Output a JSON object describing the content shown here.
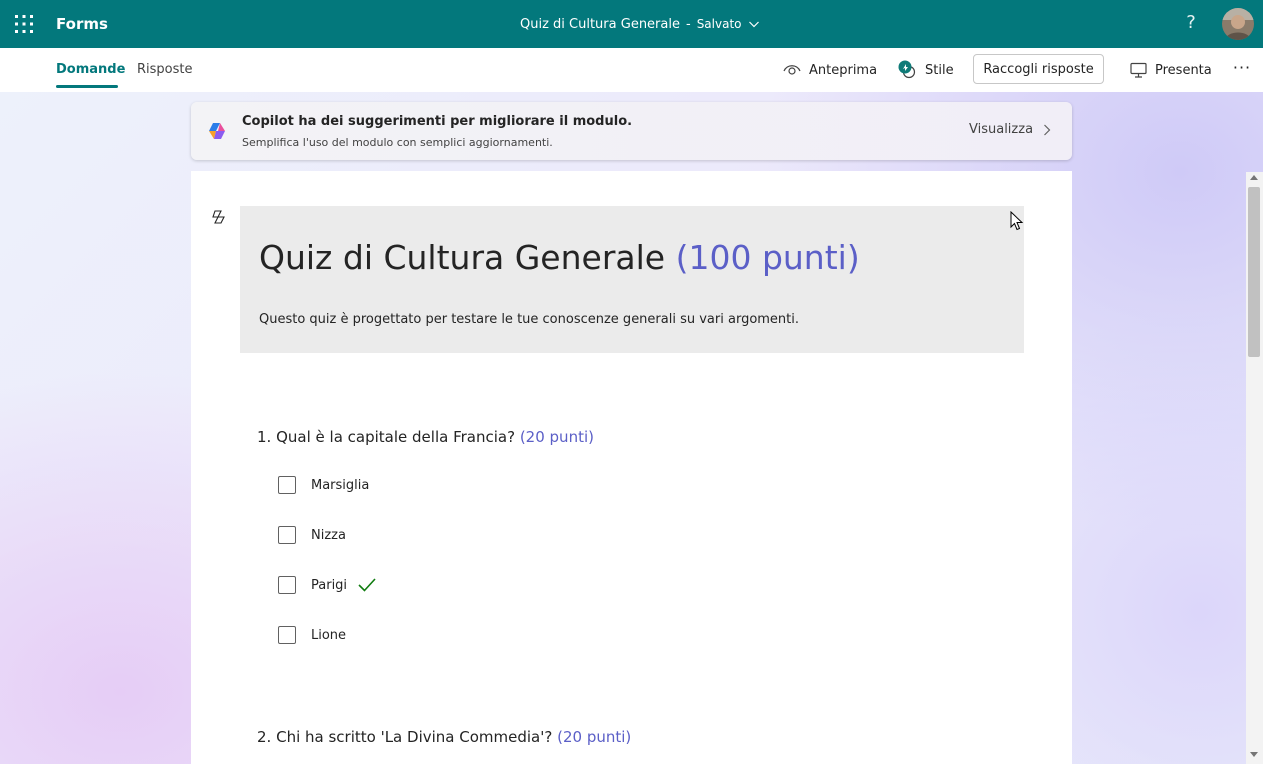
{
  "app": {
    "name": "Forms",
    "form_title": "Quiz di Cultura Generale",
    "separator": "-",
    "save_status": "Salvato"
  },
  "header": {
    "help_icon": "?",
    "icons": [
      "waffle-icon",
      "chevron-down-icon",
      "help-icon",
      "avatar"
    ]
  },
  "tabs": [
    {
      "label": "Domande",
      "active": true
    },
    {
      "label": "Risposte",
      "active": false
    }
  ],
  "toolbar": {
    "preview_label": "Anteprima",
    "style_label": "Stile",
    "collect_label": "Raccogli risposte",
    "present_label": "Presenta",
    "more_label": "···"
  },
  "copilot_banner": {
    "title": "Copilot ha dei suggerimenti per migliorare il modulo.",
    "subtitle": "Semplifica l'uso del modulo con semplici aggiornamenti.",
    "action": "Visualizza"
  },
  "form": {
    "title": "Quiz di Cultura Generale",
    "total_points": "(100 punti)",
    "description": "Questo quiz è progettato per testare le tue conoscenze generali su vari argomenti."
  },
  "questions": [
    {
      "number": "1.",
      "text": "Qual è la capitale della Francia?",
      "points": "(20 punti)",
      "options": [
        {
          "label": "Marsiglia",
          "correct": false
        },
        {
          "label": "Nizza",
          "correct": false
        },
        {
          "label": "Parigi",
          "correct": true
        },
        {
          "label": "Lione",
          "correct": false
        }
      ]
    },
    {
      "number": "2.",
      "text": "Chi ha scritto 'La Divina Commedia'?",
      "points": "(20 punti)"
    }
  ],
  "colors": {
    "brand": "#03787c",
    "points": "#5b5fc7",
    "correct": "#107c10"
  }
}
